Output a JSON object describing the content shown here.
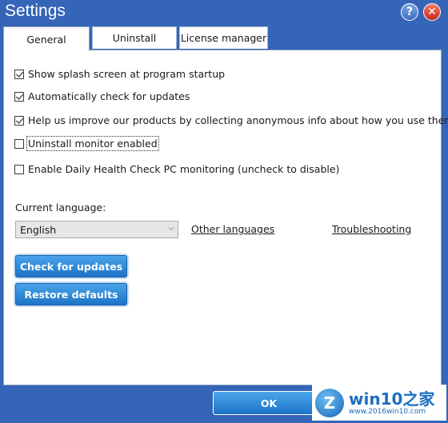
{
  "window": {
    "title": "Settings"
  },
  "titlebar": {
    "help_glyph": "?",
    "close_glyph": "✕",
    "help_icon": "question-circle-icon",
    "close_icon": "close-circle-icon"
  },
  "tabs": [
    {
      "label": "General",
      "active": true
    },
    {
      "label": "Uninstall",
      "active": false
    },
    {
      "label": "License manager",
      "active": false
    }
  ],
  "options": [
    {
      "label": "Show splash screen at program startup",
      "checked": true
    },
    {
      "label": "Automatically check for updates",
      "checked": true
    },
    {
      "label": "Help us improve our products by collecting anonymous info about how you use them",
      "checked": true
    },
    {
      "label": "Uninstall monitor enabled",
      "checked": false
    },
    {
      "label": "Enable Daily Health Check PC monitoring (uncheck to disable)",
      "checked": false
    }
  ],
  "language": {
    "label": "Current language:",
    "selected": "English",
    "other_link": "Other languages",
    "troubleshoot_link": "Troubleshooting"
  },
  "buttons": {
    "check_updates": "Check for updates",
    "restore_defaults": "Restore defaults",
    "ok": "OK"
  },
  "watermark": {
    "main": "win10之家",
    "sub": "www.2016win10.com",
    "logo_glyph": "Z"
  },
  "colors": {
    "frame": "#3565b6",
    "button_blue": "#1d74c7",
    "close_red": "#c7291b"
  }
}
